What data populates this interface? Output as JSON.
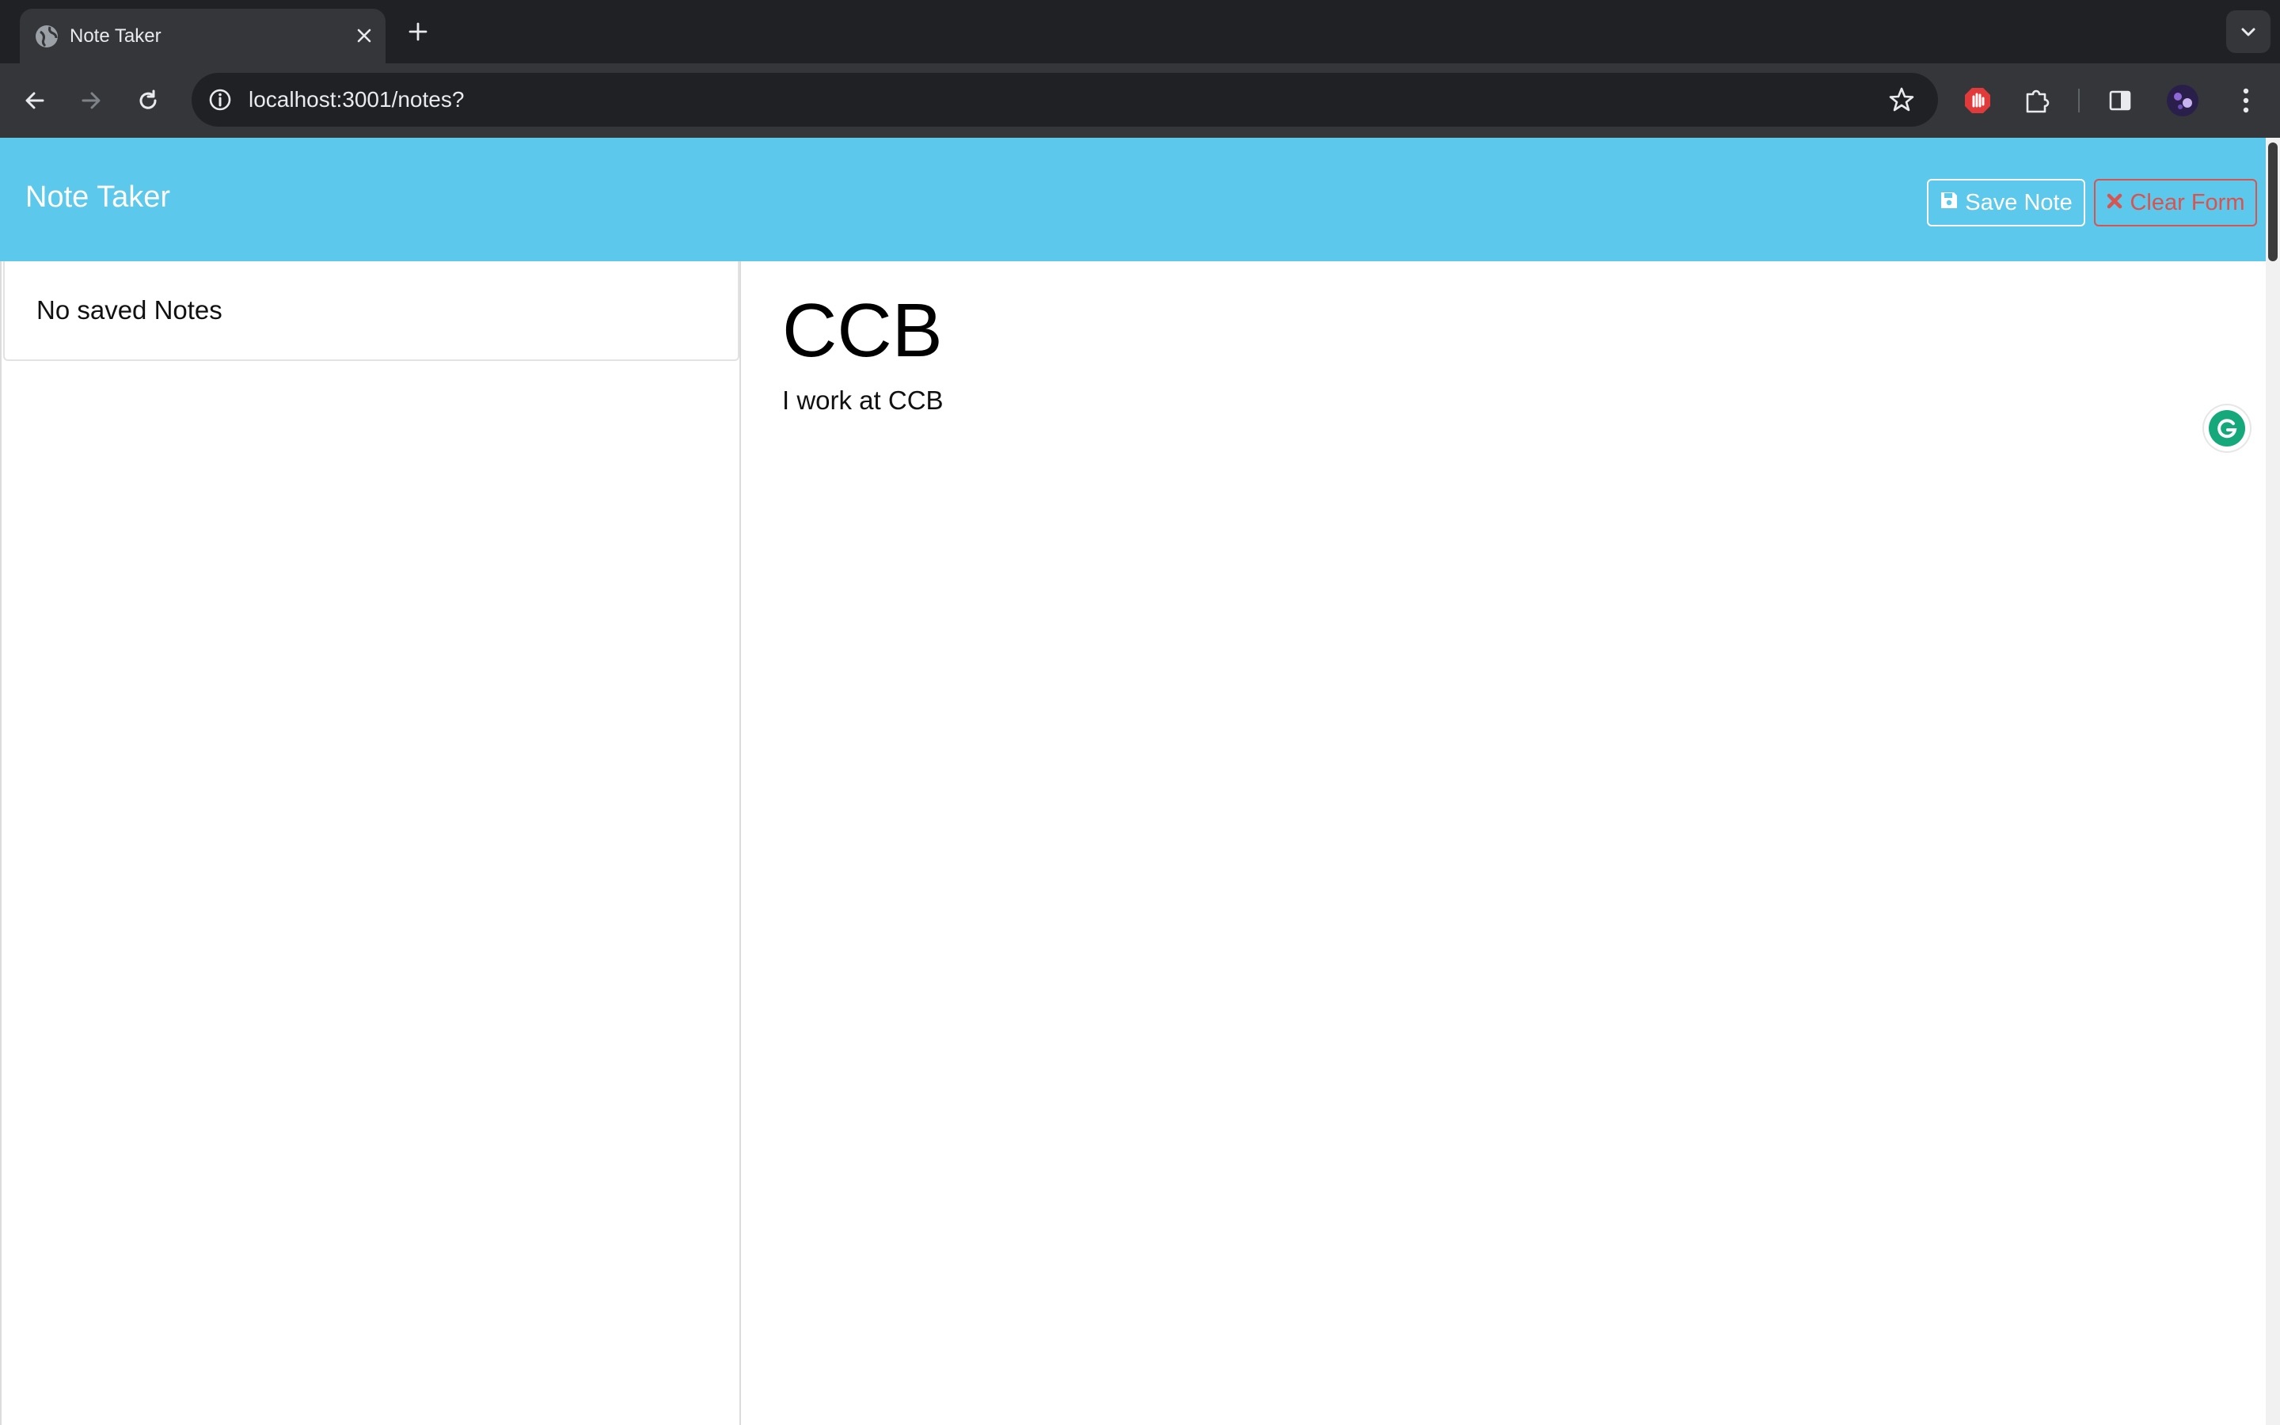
{
  "browser": {
    "tab": {
      "title": "Note Taker",
      "favicon": "globe-icon",
      "close_icon": "close-icon"
    },
    "new_tab_icon": "plus-icon",
    "tab_search_icon": "chevron-down-icon",
    "toolbar": {
      "back_icon": "arrow-left-icon",
      "forward_icon": "arrow-right-icon",
      "reload_icon": "reload-icon",
      "site_info_icon": "info-icon",
      "url": "localhost:3001/notes?",
      "bookmark_icon": "star-icon",
      "extensions": [
        "adblock-icon",
        "puzzle-icon"
      ],
      "side_panel_icon": "side-panel-icon",
      "profile_icon": "avatar",
      "menu_icon": "kebab-menu-icon"
    }
  },
  "app": {
    "brand": "Note Taker",
    "colors": {
      "navbar": "#5bc8ec",
      "danger": "#d9534f"
    },
    "actions": {
      "save": {
        "label": "Save Note",
        "icon": "save-icon"
      },
      "clear": {
        "label": "Clear Form",
        "icon": "close-icon"
      }
    },
    "sidebar": {
      "empty_message": "No saved Notes"
    },
    "note": {
      "title": "CCB",
      "text": "I work at CCB"
    },
    "grammarly_icon": "grammarly-icon"
  }
}
